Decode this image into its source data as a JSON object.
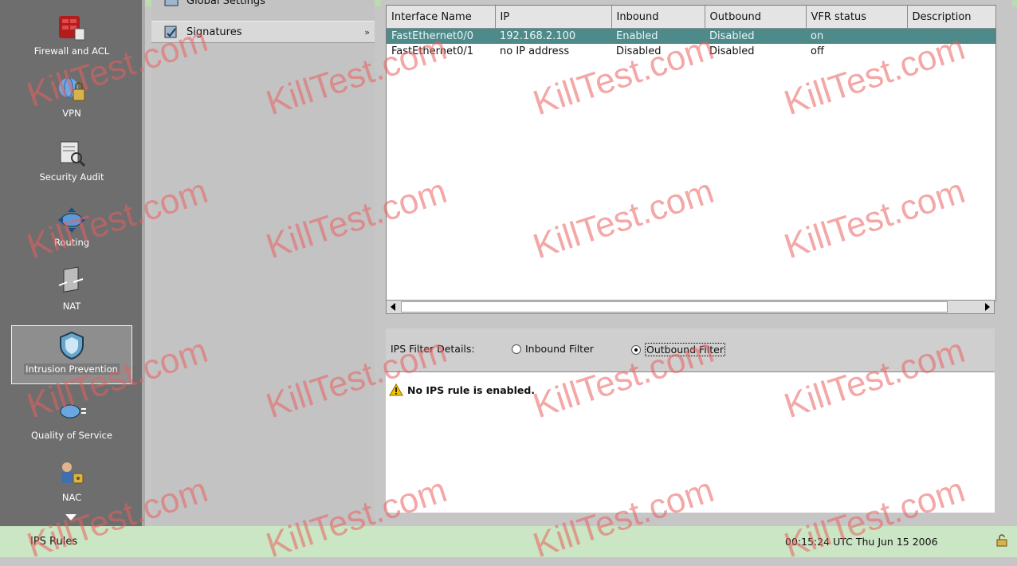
{
  "nav": {
    "items": [
      {
        "label": "Firewall and ACL"
      },
      {
        "label": "VPN"
      },
      {
        "label": "Security Audit"
      },
      {
        "label": "Routing"
      },
      {
        "label": "NAT"
      },
      {
        "label": "Intrusion Prevention"
      },
      {
        "label": "Quality of Service"
      },
      {
        "label": "NAC"
      }
    ]
  },
  "tree": {
    "items": [
      {
        "label": "Global Settings"
      },
      {
        "label": "Signatures"
      }
    ]
  },
  "interfaces_table": {
    "columns": [
      "Interface Name",
      "IP",
      "Inbound",
      "Outbound",
      "VFR status",
      "Description"
    ],
    "rows": [
      {
        "interface": "FastEthernet0/0",
        "ip": "192.168.2.100",
        "inbound": "Enabled",
        "outbound": "Disabled",
        "vfr": "on",
        "description": ""
      },
      {
        "interface": "FastEthernet0/1",
        "ip": "no IP address",
        "inbound": "Disabled",
        "outbound": "Disabled",
        "vfr": "off",
        "description": ""
      }
    ]
  },
  "filter": {
    "label": "IPS Filter Details:",
    "inbound_label": "Inbound Filter",
    "outbound_label": "Outbound Filter",
    "selected": "Outbound Filter"
  },
  "details": {
    "message": "No IPS rule is enabled."
  },
  "status": {
    "left": "IPS Rules",
    "right": "00:15:24 UTC Thu Jun 15 2006"
  },
  "watermark": "KillTest.com",
  "colors": {
    "selected_row": "#4f8a8b",
    "status_bar": "#cbe6c4",
    "watermark": "#eb5f5f"
  }
}
